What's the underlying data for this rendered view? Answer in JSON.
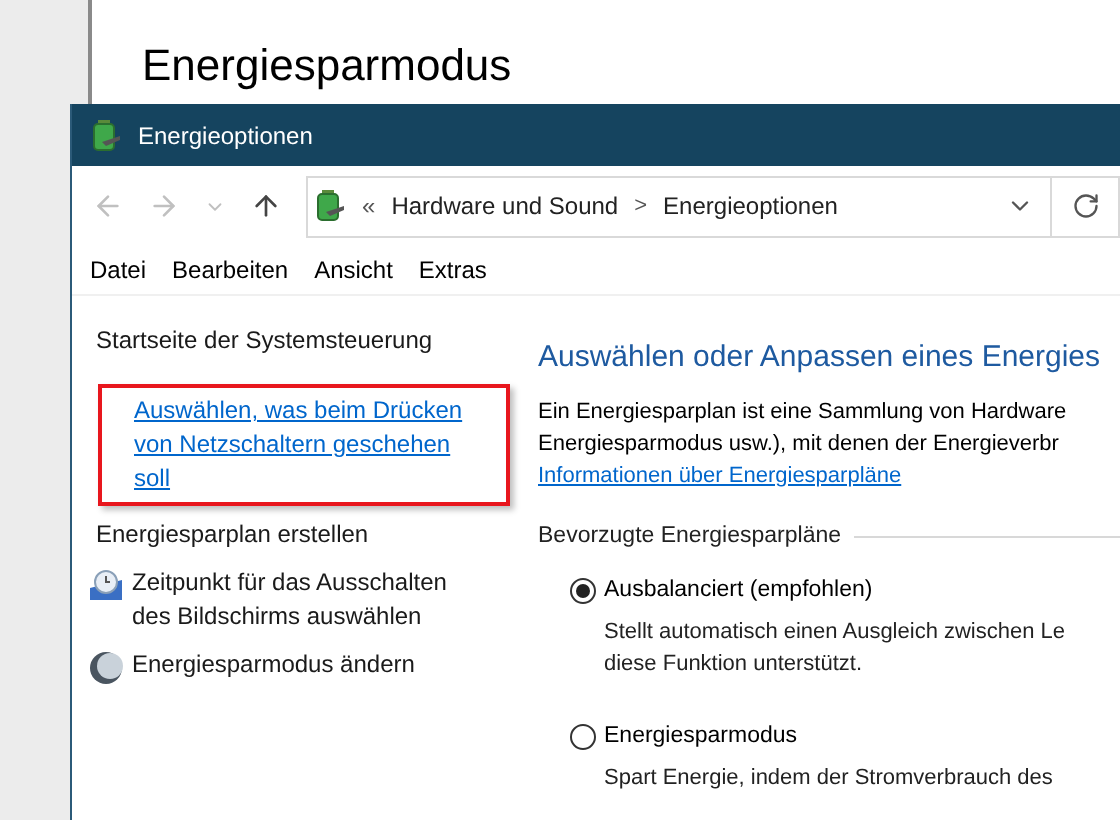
{
  "background_window": {
    "heading": "Energiesparmodus"
  },
  "window": {
    "title": "Energieoptionen"
  },
  "address_bar": {
    "prefix": "«",
    "path": [
      {
        "label": "Hardware und Sound"
      },
      {
        "label": "Energieoptionen"
      }
    ],
    "separator": ">"
  },
  "menu": [
    "Datei",
    "Bearbeiten",
    "Ansicht",
    "Extras"
  ],
  "sidebar": {
    "items": [
      {
        "label": "Startseite der Systemsteuerung",
        "kind": "plain",
        "highlighted": false
      },
      {
        "label": "Auswählen, was beim Drücken von Netzschaltern geschehen soll",
        "kind": "link",
        "highlighted": true
      },
      {
        "label": "Energiesparplan erstellen",
        "kind": "plain",
        "highlighted": false
      },
      {
        "label": "Zeitpunkt für das Ausschalten des Bildschirms auswählen",
        "kind": "clock",
        "highlighted": false
      },
      {
        "label": "Energiesparmodus ändern",
        "kind": "moon",
        "highlighted": false
      }
    ]
  },
  "main": {
    "heading": "Auswählen oder Anpassen eines Energies",
    "intro": [
      "Ein Energiesparplan ist eine Sammlung von Hardware",
      "Energiesparmodus usw.), mit denen der Energieverbr"
    ],
    "info_link": "Informationen über Energiesparpläne",
    "group_label": "Bevorzugte Energiesparpläne",
    "plans": [
      {
        "name": "Ausbalanciert (empfohlen)",
        "selected": true,
        "description": [
          "Stellt automatisch einen Ausgleich zwischen Le",
          "diese Funktion unterstützt."
        ]
      },
      {
        "name": "Energiesparmodus",
        "selected": false,
        "description": [
          "Spart Energie, indem der Stromverbrauch des"
        ]
      }
    ]
  }
}
